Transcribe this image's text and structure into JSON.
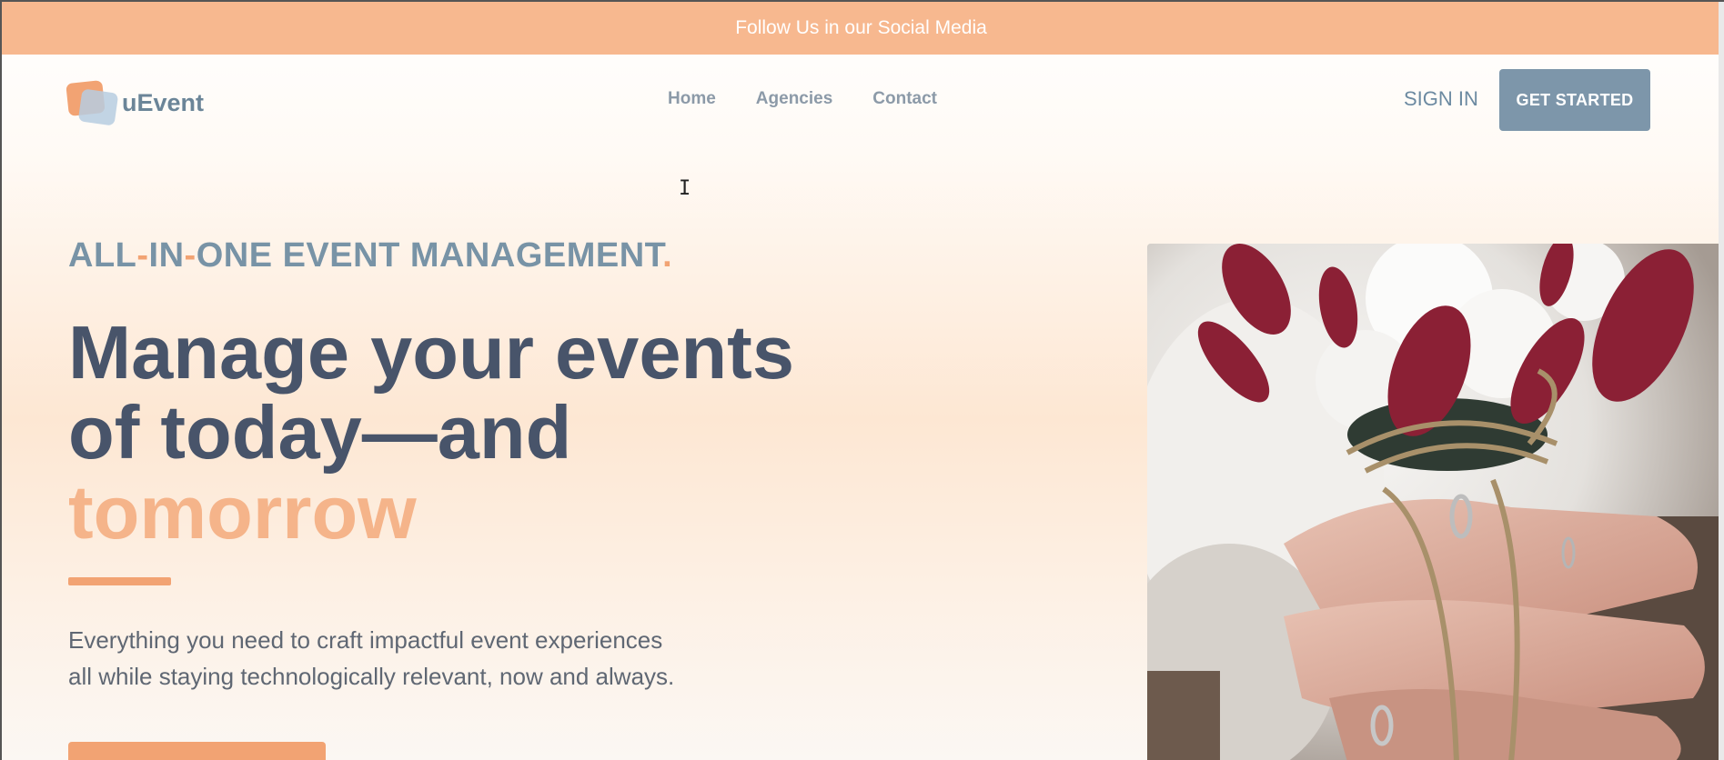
{
  "topbar": {
    "text": "Follow Us in our Social Media"
  },
  "nav": {
    "logo_text": "uEvent",
    "links": [
      "Home",
      "Agencies",
      "Contact"
    ],
    "signin_label": "SIGN IN",
    "get_started_label": "GET STARTED"
  },
  "hero": {
    "tagline_parts": [
      "ALL",
      "-",
      "IN",
      "-",
      "ONE EVENT MANAGEMENT",
      "."
    ],
    "headline_line1": "Manage your events",
    "headline_line2": "of today—and",
    "headline_line3": "tomorrow",
    "description_line1": "Everything you need to craft impactful event experiences",
    "description_line2": "all while staying technologically relevant, now and always."
  },
  "colors": {
    "topbar": "#f7b88f",
    "accent_orange": "#f2a373",
    "slate_blue": "#7d96aa",
    "headline": "#48546a"
  },
  "icons": {
    "cursor": "text-cursor-icon"
  }
}
